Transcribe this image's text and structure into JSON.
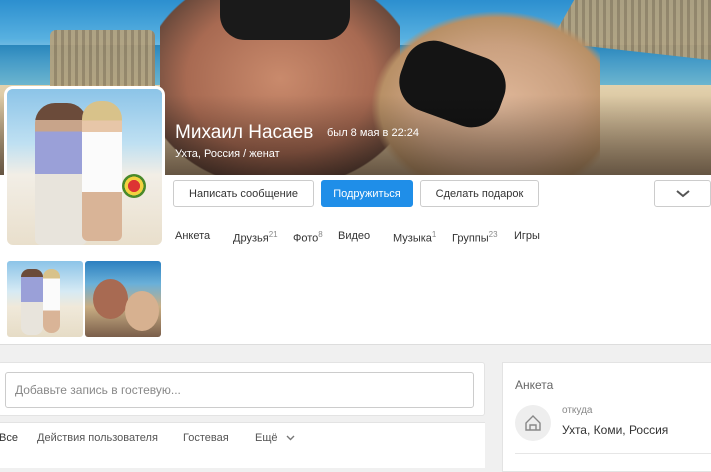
{
  "profile": {
    "name": "Михаил Насаев",
    "last_seen": "был 8 мая в 22:24",
    "location_status": "Ухта, Россия / женат"
  },
  "actions": {
    "message": "Написать сообщение",
    "add_friend": "Подружиться",
    "gift": "Сделать подарок"
  },
  "nav": [
    {
      "label": "Анкета",
      "count": ""
    },
    {
      "label": "Друзья",
      "count": "21"
    },
    {
      "label": "Фото",
      "count": "8"
    },
    {
      "label": "Видео",
      "count": ""
    },
    {
      "label": "Музыка",
      "count": "1"
    },
    {
      "label": "Группы",
      "count": "23"
    },
    {
      "label": "Игры",
      "count": ""
    }
  ],
  "guestbook": {
    "placeholder": "Добавьте запись в гостевую..."
  },
  "feed_tabs": [
    "Все",
    "Действия пользователя",
    "Гостевая",
    "Ещё"
  ],
  "anketa": {
    "title": "Анкета",
    "origin_label": "откуда",
    "origin_value": "Ухта, Коми, Россия"
  },
  "colors": {
    "primary": "#1f8ee8"
  }
}
